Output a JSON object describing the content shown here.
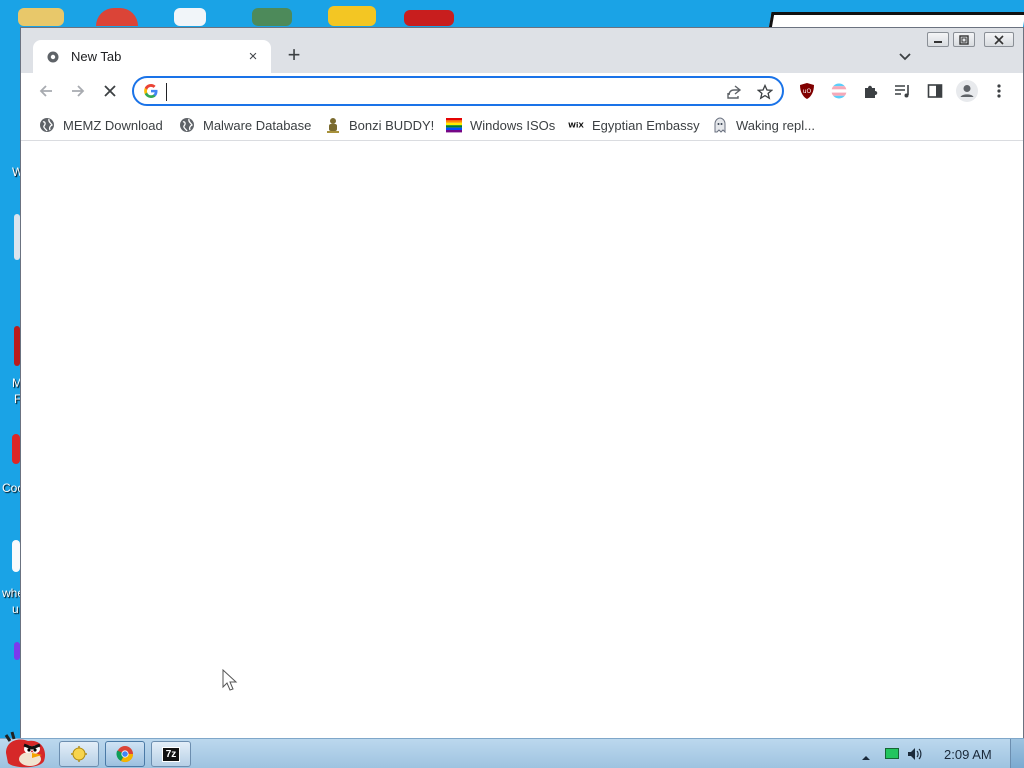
{
  "desktop": {
    "icon_labels": [
      "W",
      "M",
      "F",
      "Coo",
      "whe",
      "u"
    ]
  },
  "browser": {
    "tab": {
      "title": "New Tab",
      "close": "×"
    },
    "new_tab": "+",
    "window_controls": [
      "minimize",
      "restore",
      "close"
    ],
    "omnibox": {
      "value": "",
      "placeholder": ""
    },
    "bookmarks": [
      {
        "label": "MEMZ Download",
        "icon": "globe-icon"
      },
      {
        "label": "Malware Database",
        "icon": "globe-icon"
      },
      {
        "label": "Bonzi BUDDY!",
        "icon": "bonzi-icon"
      },
      {
        "label": "Windows ISOs",
        "icon": "rainbow-flag-icon"
      },
      {
        "label": "Egyptian Embassy",
        "icon": "wix-icon"
      },
      {
        "label": "Waking repl...",
        "icon": "ghost-icon"
      }
    ],
    "wix_logo_text": "WiX",
    "extensions": [
      "ublock-icon",
      "trans-flag-icon",
      "puzzle-icon",
      "media-icon",
      "side-panel-icon",
      "profile-icon",
      "menu-icon"
    ]
  },
  "taskbar": {
    "clock": "2:09 AM",
    "apps": [
      "explorer",
      "chrome",
      "7-zip"
    ],
    "seven_zip_label": "7z"
  },
  "colors": {
    "desktop": "#1aa3e6",
    "accent": "#1a73e8",
    "tabstrip": "#dee1e6",
    "ublock": "#800000"
  }
}
